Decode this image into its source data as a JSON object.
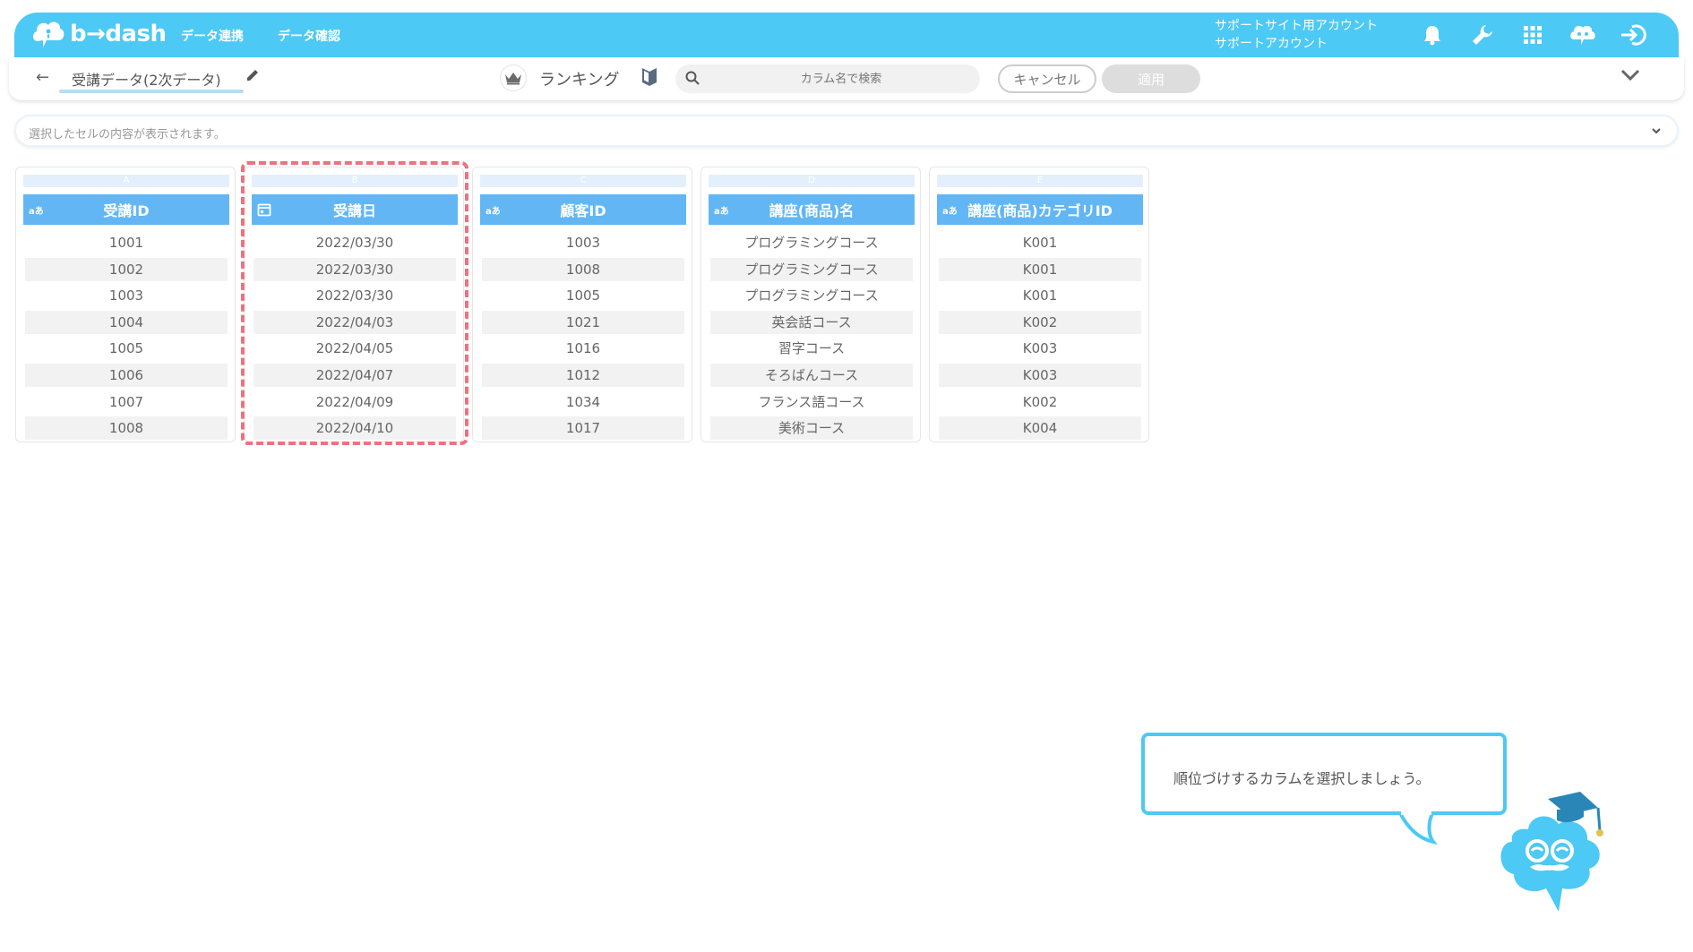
{
  "header": {
    "logo_text": "b→dash",
    "nav": [
      "データ連携",
      "データ確認"
    ],
    "account_line1": "サポートサイト用アカウント",
    "account_line2": "サポートアカウント"
  },
  "toolbar": {
    "back": "←",
    "data_name": "受講データ(2次データ)",
    "mode_label": "ランキング",
    "search_placeholder": "カラム名で検索",
    "cancel_label": "キャンセル",
    "apply_label": "適用"
  },
  "cellbar": {
    "text": "選択したセルの内容が表示されます。"
  },
  "columns": [
    {
      "letter": "A",
      "type": "aあ",
      "name": "受講ID",
      "values": [
        "1001",
        "1002",
        "1003",
        "1004",
        "1005",
        "1006",
        "1007",
        "1008"
      ]
    },
    {
      "letter": "B",
      "type": "date",
      "name": "受講日",
      "values": [
        "2022/03/30",
        "2022/03/30",
        "2022/03/30",
        "2022/04/03",
        "2022/04/05",
        "2022/04/07",
        "2022/04/09",
        "2022/04/10"
      ]
    },
    {
      "letter": "C",
      "type": "aあ",
      "name": "顧客ID",
      "values": [
        "1003",
        "1008",
        "1005",
        "1021",
        "1016",
        "1012",
        "1034",
        "1017"
      ]
    },
    {
      "letter": "D",
      "type": "aあ",
      "name": "講座(商品)名",
      "values": [
        "プログラミングコース",
        "プログラミングコース",
        "プログラミングコース",
        "英会話コース",
        "習字コース",
        "そろばんコース",
        "フランス語コース",
        "美術コース"
      ]
    },
    {
      "letter": "E",
      "type": "aあ",
      "name": "講座(商品)カテゴリID",
      "values": [
        "K001",
        "K001",
        "K001",
        "K002",
        "K003",
        "K003",
        "K002",
        "K004"
      ]
    }
  ],
  "tooltip": {
    "text": "順位づけするカラムを選択しましょう。"
  },
  "colors": {
    "brand": "#4cc9f5",
    "header_cell": "#62b6f4",
    "highlight": "#f0707d"
  }
}
